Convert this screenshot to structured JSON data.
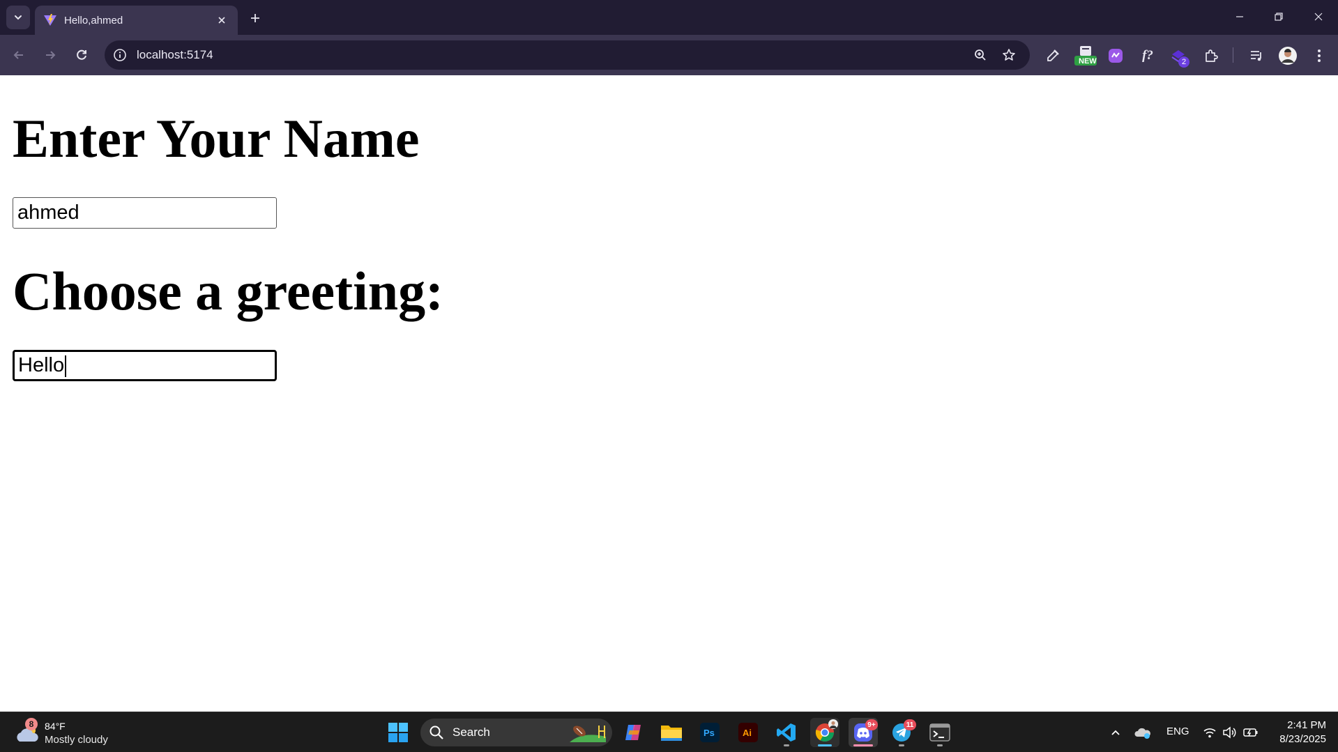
{
  "browser": {
    "tab": {
      "title": "Hello,ahmed"
    },
    "address_bar": {
      "url": "localhost:5174"
    },
    "extensions": {
      "new_badge": "NEW",
      "ext_count_badge": "2"
    }
  },
  "page": {
    "name_heading": "Enter Your Name",
    "name_input_value": "ahmed",
    "greeting_heading": "Choose a greeting:",
    "greeting_input_value": "Hello"
  },
  "taskbar": {
    "weather": {
      "badge": "8",
      "temperature": "84°F",
      "condition": "Mostly cloudy"
    },
    "search": {
      "label": "Search"
    },
    "badges": {
      "discord": "9+",
      "telegram": "11"
    },
    "tray": {
      "language": "ENG"
    },
    "clock": {
      "time": "2:41 PM",
      "date": "8/23/2025"
    }
  },
  "colors": {
    "titlebar": "#211c33",
    "toolbar": "#3b3550",
    "taskbar": "#1c1c1c",
    "accent_blue": "#4cc2ff"
  }
}
